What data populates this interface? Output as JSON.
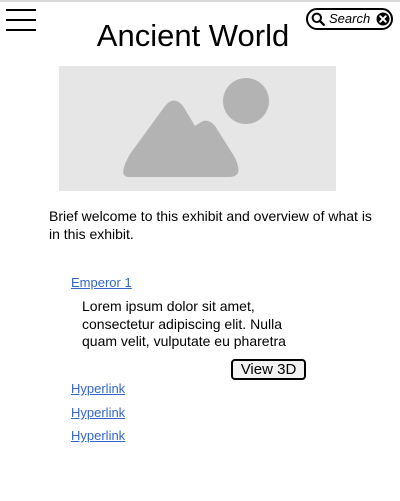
{
  "header": {
    "menu_icon": "hamburger-menu-icon",
    "title": "Ancient World",
    "search": {
      "placeholder": "Search",
      "search_icon": "magnifier-icon",
      "clear_icon": "close-circle-icon"
    }
  },
  "hero": {
    "image_icon": "image-placeholder-icon",
    "background": "#e6e6e6",
    "glyph_color": "#b3b3b3"
  },
  "intro": {
    "text": "Brief welcome to this exhibit and overview of what is in this exhibit."
  },
  "exhibit": {
    "link_label": "Emperor 1",
    "description": "Lorem ipsum dolor sit amet, consectetur adipiscing elit. Nulla quam velit, vulputate eu pharetra",
    "view_button_label": "View 3D"
  },
  "links": [
    {
      "label": "Hyperlink"
    },
    {
      "label": "Hyperlink"
    },
    {
      "label": "Hyperlink"
    }
  ],
  "colors": {
    "link": "#3366cc",
    "text": "#000000",
    "button_bg": "#f2f2f2"
  }
}
